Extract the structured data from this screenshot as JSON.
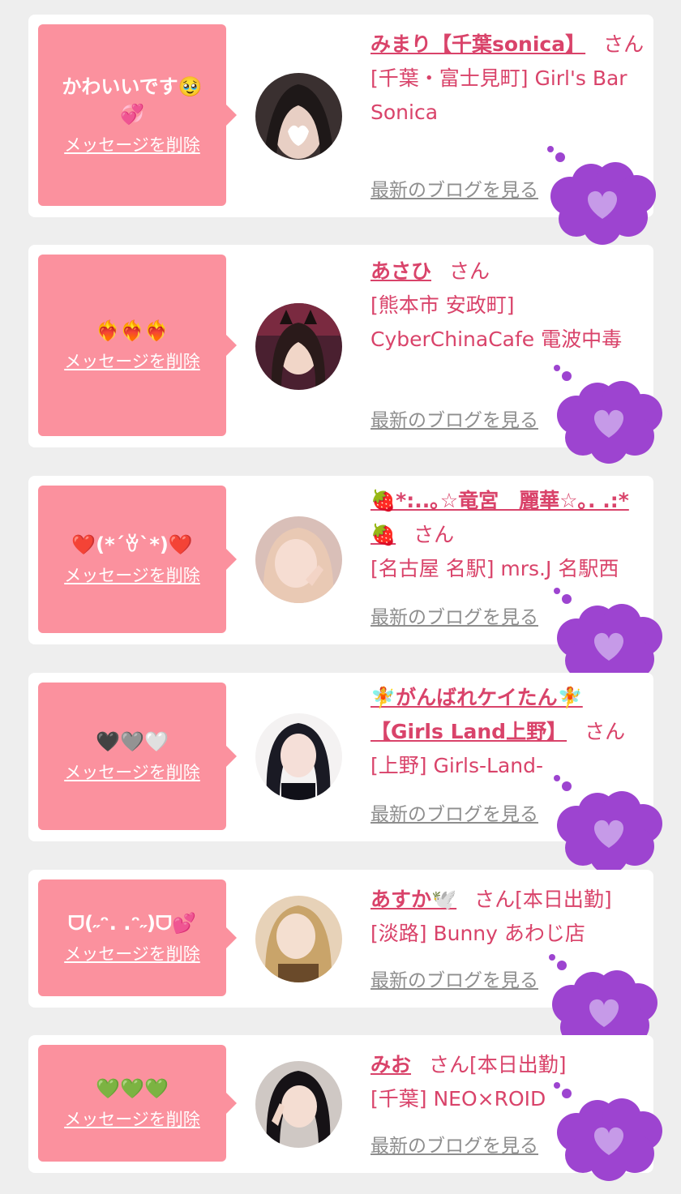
{
  "colors": {
    "page_bg": "#eeeeee",
    "card_bg": "#ffffff",
    "bubble_bg": "#fb919e",
    "name_text": "#d9436a",
    "blog_link": "#8e8e8e",
    "cloud": "#9d44d0"
  },
  "delete_label": "メッセージを削除",
  "san_label": "さん",
  "blog_label": "最新のブログを見る",
  "cards": [
    {
      "message": "かわいいです🥹💞",
      "name": "みまり【千葉sonica】",
      "shop": "[千葉・富士見町] Girl's Bar Sonica"
    },
    {
      "message": "❤️‍🔥❤️‍🔥❤️‍🔥",
      "name": "あさひ",
      "shop": "[熊本市 安政町] CyberChinaCafe 電波中毒"
    },
    {
      "message": "❤️(*´ꈊ`*)❤️",
      "name": "🍓*:..｡☆竜宮　麗華☆｡. .:*🍓",
      "shop": "[名古屋 名駅] mrs.J 名駅西"
    },
    {
      "message": "🖤🩶🤍",
      "name": "🧚がんばれケイたん🧚【Girls Land上野】",
      "shop": "[上野] Girls-Land-"
    },
    {
      "message": "ᗜ(˶ᵔ. .ᵔ˶)ᗜ💕",
      "name": "あすか🕊️",
      "status": "[本日出勤]",
      "shop": "[淡路] Bunny あわじ店"
    },
    {
      "message": "💚💚💚",
      "name": "みお",
      "status": "[本日出勤]",
      "shop": "[千葉] NEO×ROID"
    }
  ]
}
